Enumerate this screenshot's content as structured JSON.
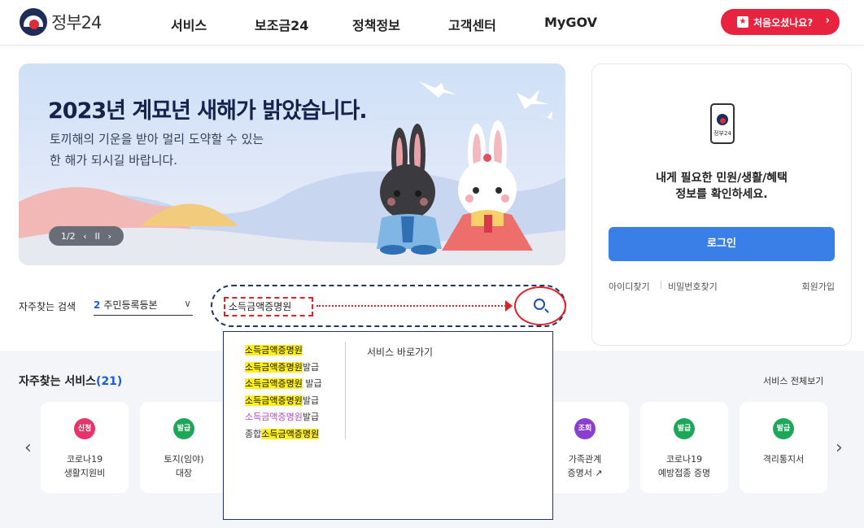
{
  "header": {
    "logo_text": "정부24",
    "nav": [
      "서비스",
      "보조금24",
      "정책정보",
      "고객센터",
      "MyGOV"
    ],
    "first_visit_label": "처음오셨나요?",
    "first_visit_arrow": "›"
  },
  "banner": {
    "title": "2023년 계묘년 새해가 밝았습니다.",
    "subtitle_line1": "토끼해의 기운을 받아 멀리 도약할 수 있는",
    "subtitle_line2": "한 해가 되시길 바랍니다.",
    "pager": {
      "current": "1/2",
      "prev": "‹",
      "pause": "II",
      "next": "›"
    }
  },
  "login": {
    "app_label": "정부24",
    "message_line1": "내게 필요한 민원/생활/혜택",
    "message_line2": "정보를 확인하세요.",
    "login_button": "로그인",
    "find_id": "아이디찾기",
    "find_pw": "비밀번호찾기",
    "signup": "회원가입"
  },
  "search": {
    "frequent_label": "자주찾는 검색",
    "frequent_rank": "2",
    "frequent_value": "주민등록등본",
    "chevron": "∨",
    "query": "소득금액증명원"
  },
  "autocomplete": {
    "items": [
      {
        "prefix": "",
        "highlight": "소득금액증명원",
        "suffix": "",
        "style": "yellow"
      },
      {
        "prefix": "",
        "highlight": "소득금액증명원",
        "suffix": "발급",
        "style": "yellow"
      },
      {
        "prefix": "",
        "highlight": "소득금액증명원",
        "suffix": " 발급",
        "style": "yellow"
      },
      {
        "prefix": "",
        "highlight": "소득금액증명원",
        "suffix": "발급",
        "style": "yellow"
      },
      {
        "prefix": "",
        "highlight": "소득금액증명원",
        "suffix": "발급",
        "style": "purple"
      },
      {
        "prefix": "종합",
        "highlight": "소득금액증명원",
        "suffix": "",
        "style": "yellow"
      }
    ],
    "shortcut_label": "서비스 바로가기"
  },
  "services": {
    "title": "자주찾는 서비스",
    "count": "(21)",
    "view_all": "서비스 전체보기",
    "prev_arrow": "‹",
    "next_arrow": "›",
    "cards": [
      {
        "badge": "신청",
        "badge_color": "#e8336b",
        "line1": "코로나19",
        "line2": "생활지원비"
      },
      {
        "badge": "발급",
        "badge_color": "#1ea65a",
        "line1": "토지(임야)",
        "line2": "대장"
      },
      {
        "badge": "조회",
        "badge_color": "#8a3fd1",
        "line1": "가족관계",
        "line2": "증명서 ↗"
      },
      {
        "badge": "발급",
        "badge_color": "#1ea65a",
        "line1": "코로나19",
        "line2": "예방접종 증명"
      },
      {
        "badge": "발급",
        "badge_color": "#1ea65a",
        "line1": "격리통지서",
        "line2": ""
      }
    ]
  },
  "colors": {
    "brand_navy": "#1c2d5a",
    "brand_red": "#e8233f",
    "login_blue": "#3a7ee8",
    "annotation_red": "#e0202a",
    "highlight_yellow": "#ffef1f"
  }
}
